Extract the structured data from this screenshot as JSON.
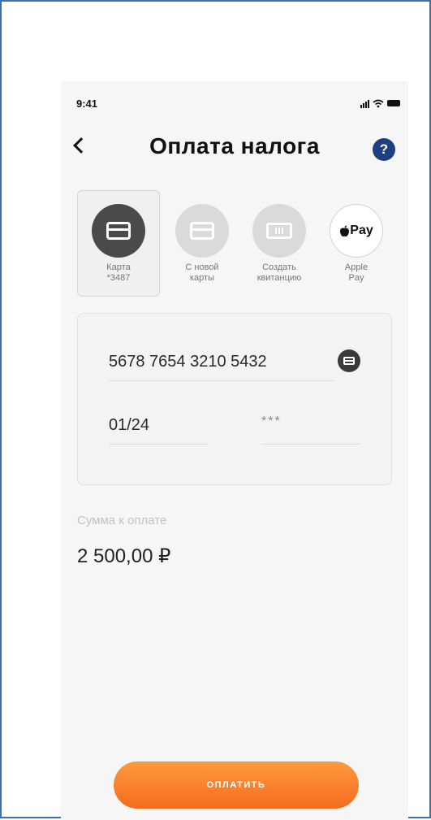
{
  "status_bar": {
    "time": "9:41"
  },
  "header": {
    "title": "Оплата налога",
    "help_glyph": "?"
  },
  "payment_methods": [
    {
      "label": "Карта\n*3487",
      "icon": "card-icon",
      "selected": true,
      "color": "#4a4a4a"
    },
    {
      "label": "С новой\nкарты",
      "icon": "card-icon",
      "selected": false,
      "color": "#dadada"
    },
    {
      "label": "Создать\nквитанцию",
      "icon": "ticket-icon",
      "selected": false,
      "color": "#dadada"
    },
    {
      "label": "Apple\nPay",
      "icon": "apple-pay-icon",
      "brand_text": "Pay",
      "selected": false,
      "color": "#ffffff"
    }
  ],
  "card_form": {
    "card_number": "5678 7654 3210 5432",
    "expiry": "01/24",
    "cvv": "***"
  },
  "amount": {
    "label": "Сумма к оплате",
    "value": "2 500,00 ₽"
  },
  "pay_button": {
    "label": "ОПЛАТИТЬ"
  },
  "colors": {
    "frame_border": "#3c6fb5",
    "help_icon": "#1e3f80",
    "accent_orange": "#f56b1e",
    "selected_method": "#4a4a4a"
  }
}
